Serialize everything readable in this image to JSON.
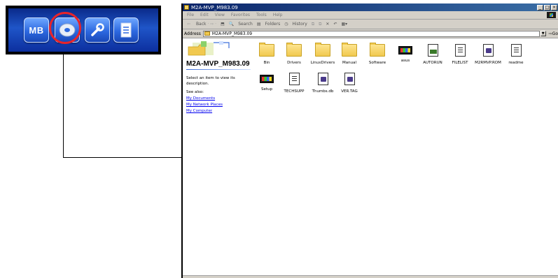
{
  "launcher": {
    "mb_label": "MB",
    "colors": {
      "highlight_ring": "#e8242a",
      "panel": "#1f55c8"
    }
  },
  "window": {
    "title": "M2A-MVP_M983.09",
    "menu": [
      "File",
      "Edit",
      "View",
      "Favorites",
      "Tools",
      "Help"
    ],
    "toolbar": {
      "back": "Back",
      "search": "Search",
      "folders": "Folders",
      "history": "History"
    },
    "address": {
      "label": "Address",
      "value": "M2A-MVP_M983.09",
      "go": "Go"
    }
  },
  "info_pane": {
    "folder_title": "M2A-MVP_M983.09",
    "select_text": "Select an item to view its description.",
    "see_also": "See also:",
    "links": [
      "My Documents",
      "My Network Places",
      "My Computer"
    ]
  },
  "files": [
    {
      "name": "Bin",
      "icon": "folder-icon"
    },
    {
      "name": "Drivers",
      "icon": "folder-icon"
    },
    {
      "name": "LinuxDrivers",
      "icon": "folder-icon"
    },
    {
      "name": "Manual",
      "icon": "folder-icon"
    },
    {
      "name": "Software",
      "icon": "folder-icon"
    },
    {
      "name": "asus",
      "icon": "exe-icon"
    },
    {
      "name": "AUTORUN",
      "icon": "inf-icon"
    },
    {
      "name": "FILELIST",
      "icon": "doc-icon"
    },
    {
      "name": "M2RMVP.ROM",
      "icon": "sys-icon"
    },
    {
      "name": "readme",
      "icon": "doc-icon"
    },
    {
      "name": "Setup",
      "icon": "exe-icon"
    },
    {
      "name": "TECHSUPP",
      "icon": "doc-icon"
    },
    {
      "name": "Thumbs.db",
      "icon": "sys-icon"
    },
    {
      "name": "VER.TAG",
      "icon": "sys-icon"
    }
  ]
}
